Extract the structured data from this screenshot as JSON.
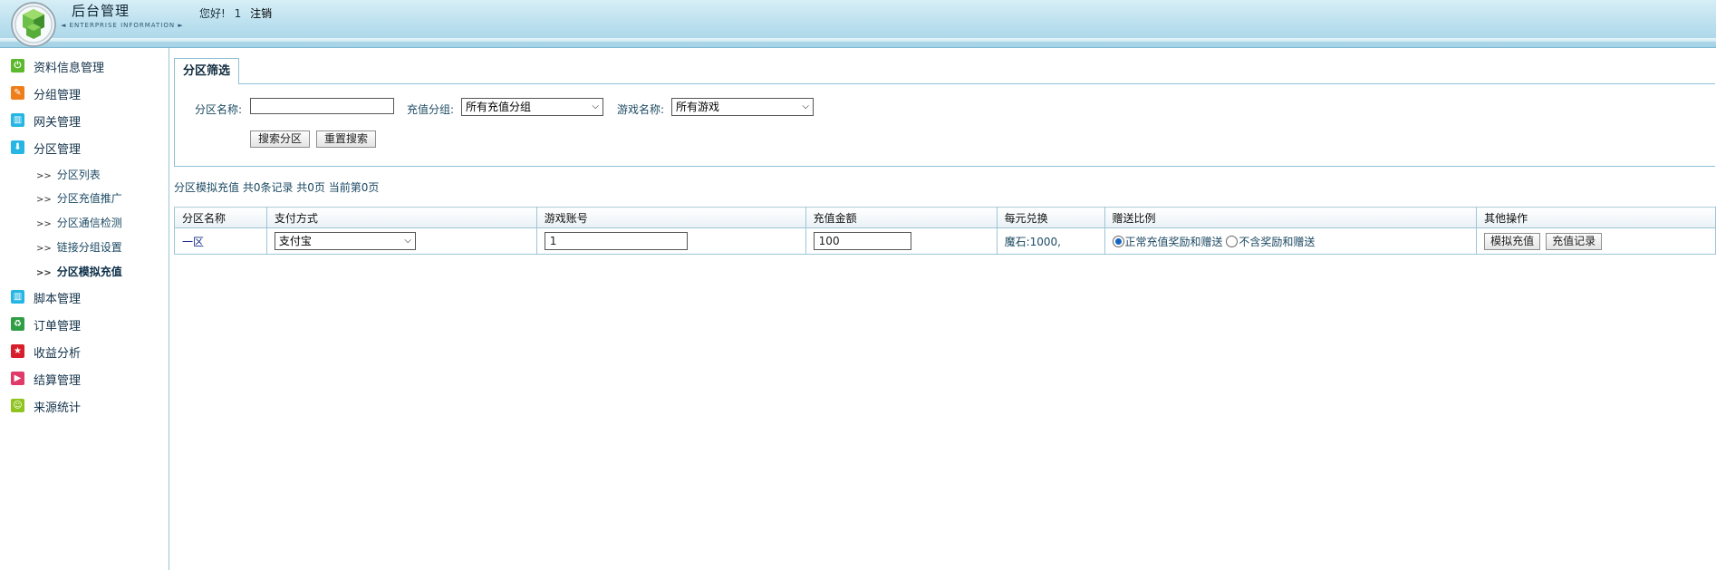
{
  "header": {
    "title": "后台管理",
    "subtitle": "◄ ENTERPRISE INFORMATION ►",
    "greeting": "您好!",
    "username": "1",
    "logout_label": "注销"
  },
  "sidebar": {
    "items": [
      {
        "label": "资料信息管理",
        "icon": "power-icon",
        "color": "#5cb82c"
      },
      {
        "label": "分组管理",
        "icon": "pencil-icon",
        "color": "#ef7d1a"
      },
      {
        "label": "网关管理",
        "icon": "grid-icon",
        "color": "#25b6e4"
      },
      {
        "label": "分区管理",
        "icon": "arrow-down-icon",
        "color": "#25b6e4"
      },
      {
        "label": "脚本管理",
        "icon": "grid-icon",
        "color": "#25b6e4"
      },
      {
        "label": "订单管理",
        "icon": "recycle-icon",
        "color": "#2f9e44"
      },
      {
        "label": "收益分析",
        "icon": "star-icon",
        "color": "#d81e2a"
      },
      {
        "label": "结算管理",
        "icon": "play-icon",
        "color": "#e03a6a"
      },
      {
        "label": "来源统计",
        "icon": "smiley-icon",
        "color": "#8fc31f"
      }
    ],
    "sub_items": [
      {
        "label": "分区列表"
      },
      {
        "label": "分区充值推广"
      },
      {
        "label": "分区通信检测"
      },
      {
        "label": "链接分组设置"
      },
      {
        "label": "分区模拟充值"
      }
    ],
    "arrow": ">>"
  },
  "filter": {
    "tab_label": "分区筛选",
    "zone_name_label": "分区名称:",
    "zone_name_value": "",
    "recharge_group_label": "充值分组:",
    "recharge_group_value": "所有充值分组",
    "game_name_label": "游戏名称:",
    "game_name_value": "所有游戏",
    "search_button": "搜索分区",
    "reset_button": "重置搜索"
  },
  "summary": "分区模拟充值 共0条记录 共0页 当前第0页",
  "table": {
    "headers": [
      "分区名称",
      "支付方式",
      "游戏账号",
      "充值金额",
      "每元兑换",
      "赠送比例",
      "其他操作"
    ],
    "rows": [
      {
        "zone": "一区",
        "payment": "支付宝",
        "account": "1",
        "amount": "100",
        "exchange": "魔石:1000,",
        "bonus_option_1": "正常充值奖励和赠送",
        "bonus_option_2": "不含奖励和赠送",
        "simulate_button": "模拟充值",
        "record_button": "充值记录"
      }
    ]
  }
}
